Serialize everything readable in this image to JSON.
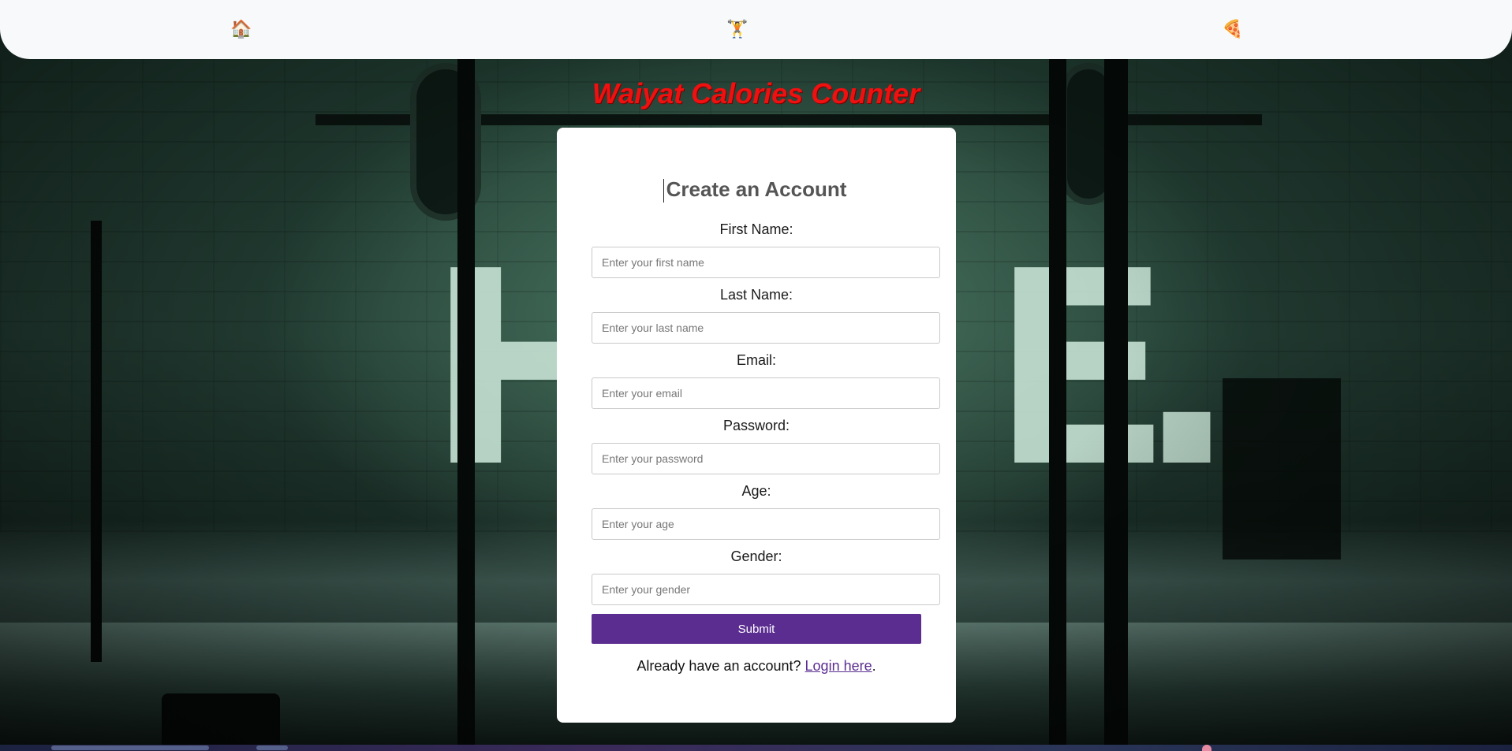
{
  "nav": {
    "items": [
      {
        "icon": "home-icon",
        "glyph": "🏠"
      },
      {
        "icon": "weightlifter-icon",
        "glyph": "🏋"
      },
      {
        "icon": "pizza-icon",
        "glyph": "🍕"
      }
    ]
  },
  "app_title": "Waiyat Calories Counter",
  "background": {
    "letters": [
      "H",
      "E",
      "."
    ]
  },
  "form": {
    "heading": "Create an Account",
    "fields": [
      {
        "label": "First Name:",
        "placeholder": "Enter your first name",
        "value": ""
      },
      {
        "label": "Last Name:",
        "placeholder": "Enter your last name",
        "value": ""
      },
      {
        "label": "Email:",
        "placeholder": "Enter your email",
        "value": ""
      },
      {
        "label": "Password:",
        "placeholder": "Enter your password",
        "value": ""
      },
      {
        "label": "Age:",
        "placeholder": "Enter your age",
        "value": ""
      },
      {
        "label": "Gender:",
        "placeholder": "Enter your gender",
        "value": ""
      }
    ],
    "submit_label": "Submit",
    "login_prompt": "Already have an account? ",
    "login_link": "Login here",
    "login_suffix": "."
  },
  "colors": {
    "title": "#f01010",
    "button": "#5b2d91",
    "nav_bg": "#f7f9fb",
    "heading": "#555555"
  }
}
